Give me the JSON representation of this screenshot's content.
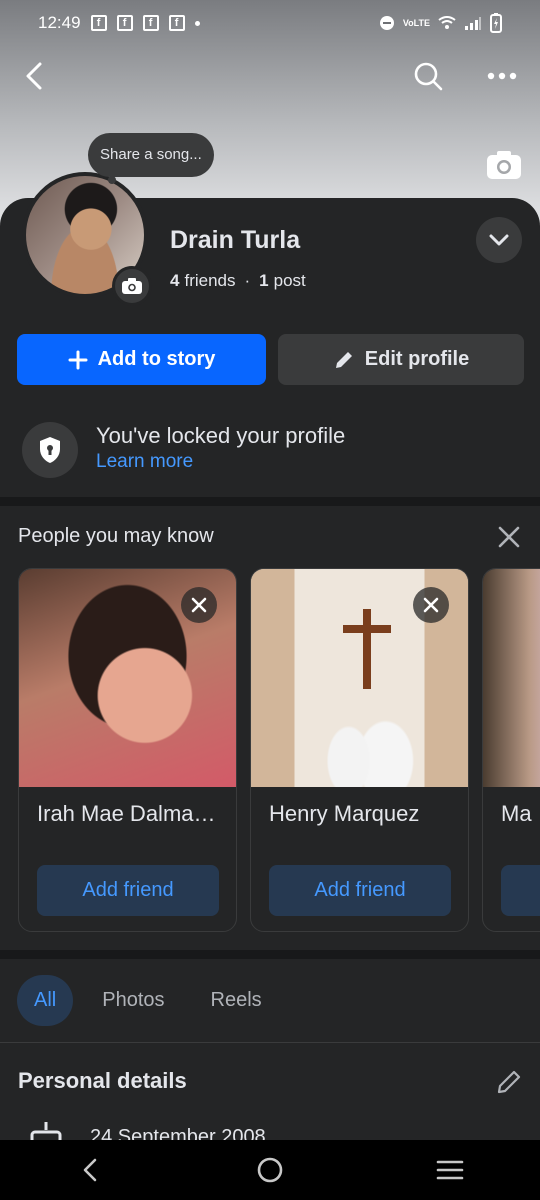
{
  "status_bar": {
    "time": "12:49",
    "network_label": "VoLTE"
  },
  "tooltip": {
    "text": "Share a song..."
  },
  "profile": {
    "name": "Drain Turla",
    "friends_count": "4",
    "friends_label": "friends",
    "separator": "·",
    "posts_count": "1",
    "posts_label": "post"
  },
  "actions": {
    "add_to_story": "Add to story",
    "edit_profile": "Edit profile"
  },
  "lock_notice": {
    "title": "You've locked your profile",
    "link": "Learn more"
  },
  "pymk": {
    "title": "People you may know",
    "cards": [
      {
        "name": "Irah Mae Dalma…",
        "button": "Add friend"
      },
      {
        "name": "Henry Marquez",
        "button": "Add friend"
      },
      {
        "name": "Ma"
      }
    ]
  },
  "tabs": [
    {
      "label": "All",
      "active": true
    },
    {
      "label": "Photos",
      "active": false
    },
    {
      "label": "Reels",
      "active": false
    }
  ],
  "personal_details": {
    "title": "Personal details",
    "birthday": "24 September 2008"
  },
  "colors": {
    "primary_blue": "#0866ff",
    "link_blue": "#4599ff",
    "background": "#242526",
    "surface": "#3a3b3c"
  }
}
